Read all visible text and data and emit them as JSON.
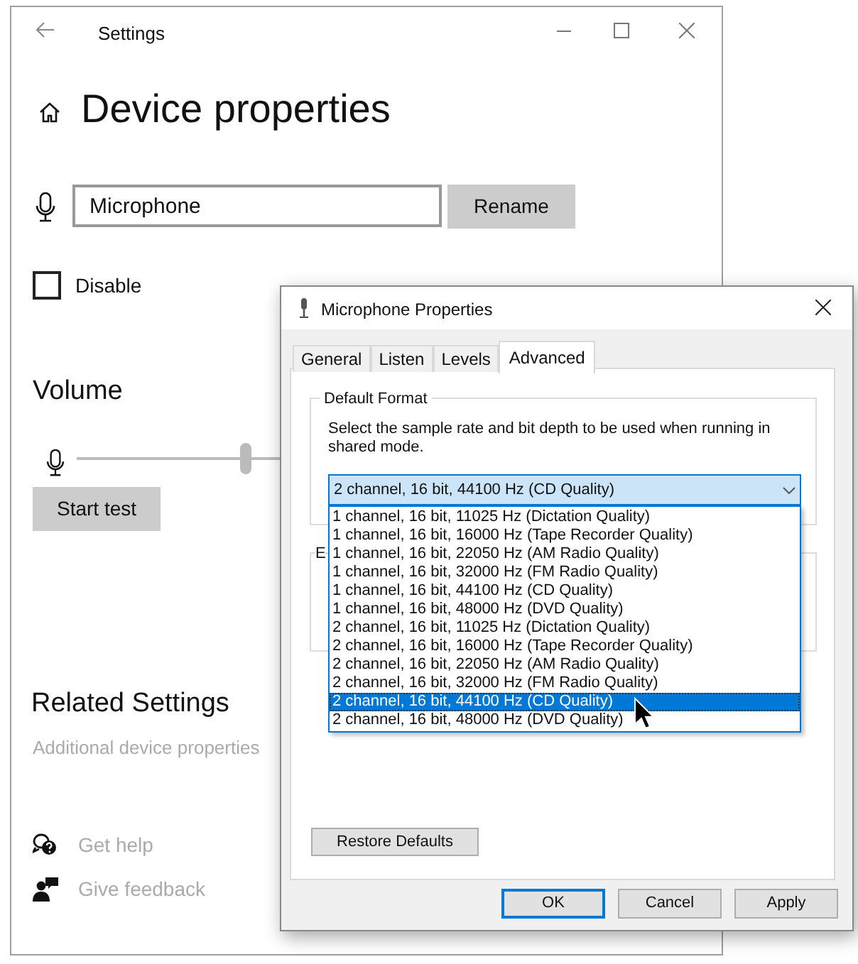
{
  "settings_window": {
    "title": "Settings",
    "heading": "Device properties",
    "name_field": {
      "value": "Microphone"
    },
    "rename_button": "Rename",
    "disable_checkbox": {
      "label": "Disable",
      "checked": false
    },
    "volume": {
      "heading": "Volume",
      "level": 0.27
    },
    "start_test_button": "Start test",
    "related_settings": {
      "heading": "Related Settings",
      "link": "Additional device properties"
    },
    "help_links": [
      {
        "kind": "help",
        "label": "Get help"
      },
      {
        "kind": "feedback",
        "label": "Give feedback"
      }
    ]
  },
  "dialog": {
    "title": "Microphone Properties",
    "tabs": [
      {
        "label": "General",
        "selected": false
      },
      {
        "label": "Listen",
        "selected": false
      },
      {
        "label": "Levels",
        "selected": false
      },
      {
        "label": "Advanced",
        "selected": true
      }
    ],
    "default_format": {
      "label": "Default Format",
      "description": "Select the sample rate and bit depth to be used when running in shared mode.",
      "dropdown": {
        "value": "2 channel, 16 bit, 44100 Hz (CD Quality)",
        "expanded": true
      },
      "options": [
        {
          "label": "1 channel, 16 bit, 11025 Hz (Dictation Quality)",
          "selected": false
        },
        {
          "label": "1 channel, 16 bit, 16000 Hz (Tape Recorder Quality)",
          "selected": false
        },
        {
          "label": "1 channel, 16 bit, 22050 Hz (AM Radio Quality)",
          "selected": false
        },
        {
          "label": "1 channel, 16 bit, 32000 Hz (FM Radio Quality)",
          "selected": false
        },
        {
          "label": "1 channel, 16 bit, 44100 Hz (CD Quality)",
          "selected": false
        },
        {
          "label": "1 channel, 16 bit, 48000 Hz (DVD Quality)",
          "selected": false
        },
        {
          "label": "2 channel, 16 bit, 11025 Hz (Dictation Quality)",
          "selected": false
        },
        {
          "label": "2 channel, 16 bit, 16000 Hz (Tape Recorder Quality)",
          "selected": false
        },
        {
          "label": "2 channel, 16 bit, 22050 Hz (AM Radio Quality)",
          "selected": false
        },
        {
          "label": "2 channel, 16 bit, 32000 Hz (FM Radio Quality)",
          "selected": false
        },
        {
          "label": "2 channel, 16 bit, 44100 Hz (CD Quality)",
          "selected": true
        },
        {
          "label": "2 channel, 16 bit, 48000 Hz (DVD Quality)",
          "selected": false
        }
      ]
    },
    "second_group": {
      "label": "E"
    },
    "restore_defaults_button": "Restore Defaults",
    "buttons": [
      {
        "label": "OK",
        "default": true
      },
      {
        "label": "Cancel",
        "default": false
      },
      {
        "label": "Apply",
        "default": false
      }
    ]
  }
}
